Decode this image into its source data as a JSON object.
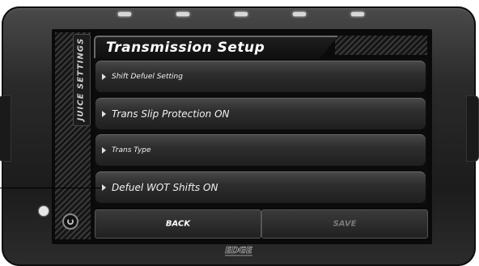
{
  "screen": {
    "title": "Transmission Setup",
    "side_tab": "JUICE SETTINGS"
  },
  "menu": {
    "items": [
      {
        "label": "Shift Defuel Setting"
      },
      {
        "label": "Trans Slip Protection ON"
      },
      {
        "label": "Trans Type"
      },
      {
        "label": "Defuel WOT Shifts ON"
      }
    ]
  },
  "buttons": {
    "back": "BACK",
    "save": "SAVE"
  },
  "device": {
    "brand": "EDGE",
    "led_count": 5
  },
  "colors": {
    "screen_bg": "#0c0c0c",
    "text": "#f0f0f0",
    "disabled_text": "#7a7a7a"
  }
}
